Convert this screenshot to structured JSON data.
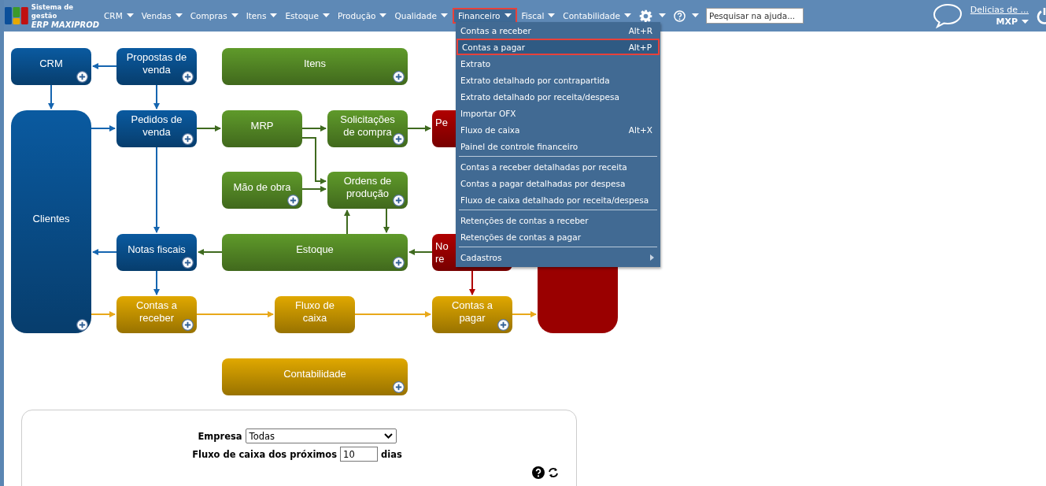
{
  "logo": {
    "line1": "Sistema de gestão",
    "line2": "ERP MAXIPROD"
  },
  "nav": [
    {
      "label": "CRM",
      "selected": false
    },
    {
      "label": "Vendas",
      "selected": false
    },
    {
      "label": "Compras",
      "selected": false
    },
    {
      "label": "Itens",
      "selected": false
    },
    {
      "label": "Estoque",
      "selected": false
    },
    {
      "label": "Produção",
      "selected": false
    },
    {
      "label": "Qualidade",
      "selected": false
    },
    {
      "label": "Financeiro",
      "selected": true
    },
    {
      "label": "Fiscal",
      "selected": false
    },
    {
      "label": "Contabilidade",
      "selected": false
    }
  ],
  "search": {
    "placeholder": "Pesquisar na ajuda..."
  },
  "user": {
    "company": "Delicias de ...",
    "code": "MXP"
  },
  "menu_groups": [
    [
      {
        "label": "Contas a receber",
        "shortcut": "Alt+R",
        "selected": false
      },
      {
        "label": "Contas a pagar",
        "shortcut": "Alt+P",
        "selected": true
      },
      {
        "label": "Extrato",
        "selected": false
      },
      {
        "label": "Extrato detalhado por contrapartida",
        "selected": false
      },
      {
        "label": "Extrato detalhado por receita/despesa",
        "selected": false
      },
      {
        "label": "Importar OFX",
        "selected": false
      },
      {
        "label": "Fluxo de caixa",
        "shortcut": "Alt+X",
        "selected": false
      },
      {
        "label": "Painel de controle financeiro",
        "selected": false
      }
    ],
    [
      {
        "label": "Contas a receber detalhadas por receita",
        "selected": false
      },
      {
        "label": "Contas a pagar detalhadas por despesa",
        "selected": false
      },
      {
        "label": "Fluxo de caixa detalhado por receita/despesa",
        "selected": false
      }
    ],
    [
      {
        "label": "Retenções de contas a receber",
        "selected": false
      },
      {
        "label": "Retenções de contas a pagar",
        "selected": false
      }
    ],
    [
      {
        "label": "Cadastros",
        "selected": false,
        "submenu": true
      }
    ]
  ],
  "nodes": [
    {
      "label": "CRM",
      "color": "#0a5aa0",
      "add_button": true
    },
    {
      "label": "Propostas de venda",
      "color": "#0a5aa0",
      "add_button": true
    },
    {
      "label": "Itens",
      "color": "#5f9a2a",
      "add_button": true
    },
    {
      "label": "Clientes",
      "color": "#0a5aa0",
      "add_button": true
    },
    {
      "label": "Pedidos de venda",
      "color": "#0a5aa0",
      "add_button": true
    },
    {
      "label": "MRP",
      "color": "#5f9a2a",
      "add_button": false
    },
    {
      "label": "Solicitações de compra",
      "color": "#5f9a2a",
      "add_button": true
    },
    {
      "label": "Pe",
      "color": "#b00000",
      "add_button": false
    },
    {
      "label": "Mão de obra",
      "color": "#5f9a2a",
      "add_button": true
    },
    {
      "label": "Ordens de produção",
      "color": "#5f9a2a",
      "add_button": true
    },
    {
      "label": "Notas fiscais",
      "color": "#0a5aa0",
      "add_button": true
    },
    {
      "label": "Estoque",
      "color": "#5f9a2a",
      "add_button": true
    },
    {
      "label": "No re",
      "color": "#b00000",
      "add_button": false
    },
    {
      "label": "Contas a receber",
      "color": "#e0a800",
      "add_button": true
    },
    {
      "label": "Fluxo de caixa",
      "color": "#e0a800",
      "add_button": false
    },
    {
      "label": "Contas a pagar",
      "color": "#e0a800",
      "add_button": true
    },
    {
      "color": "#9a0000",
      "add_button": false
    },
    {
      "label": "Contabilidade",
      "color": "#e0a800",
      "add_button": true
    }
  ],
  "filters": {
    "company_label": "Empresa",
    "company_value": "Todas",
    "days_label": "Fluxo de caixa dos próximos",
    "days_value": "10",
    "days_unit": "dias"
  }
}
